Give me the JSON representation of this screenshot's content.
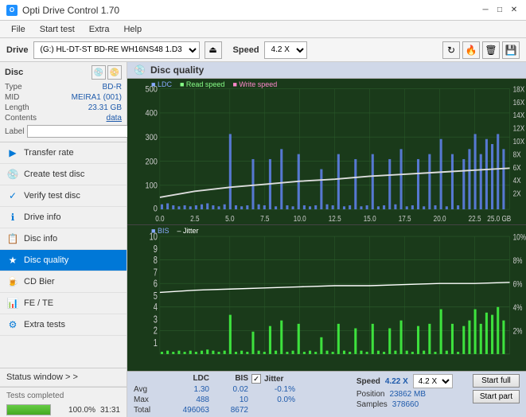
{
  "titlebar": {
    "title": "Opti Drive Control 1.70",
    "icon_text": "O",
    "minimize": "─",
    "maximize": "□",
    "close": "✕"
  },
  "menubar": {
    "items": [
      "File",
      "Start test",
      "Extra",
      "Help"
    ]
  },
  "drivebar": {
    "label": "Drive",
    "drive_value": "(G:)  HL-DT-ST BD-RE  WH16NS48 1.D3",
    "speed_label": "Speed",
    "speed_value": "4.2 X"
  },
  "disc": {
    "title": "Disc",
    "type_label": "Type",
    "type_value": "BD-R",
    "mid_label": "MID",
    "mid_value": "MEIRA1 (001)",
    "length_label": "Length",
    "length_value": "23.31 GB",
    "contents_label": "Contents",
    "contents_value": "data",
    "label_label": "Label",
    "label_value": ""
  },
  "nav": {
    "items": [
      {
        "id": "transfer-rate",
        "label": "Transfer rate",
        "icon": "▶"
      },
      {
        "id": "create-test-disc",
        "label": "Create test disc",
        "icon": "💿"
      },
      {
        "id": "verify-test-disc",
        "label": "Verify test disc",
        "icon": "✓"
      },
      {
        "id": "drive-info",
        "label": "Drive info",
        "icon": "ℹ"
      },
      {
        "id": "disc-info",
        "label": "Disc info",
        "icon": "📋"
      },
      {
        "id": "disc-quality",
        "label": "Disc quality",
        "icon": "★",
        "active": true
      },
      {
        "id": "cd-bier",
        "label": "CD Bier",
        "icon": "🍺"
      },
      {
        "id": "fe-te",
        "label": "FE / TE",
        "icon": "📊"
      },
      {
        "id": "extra-tests",
        "label": "Extra tests",
        "icon": "⚙"
      }
    ],
    "status_window": "Status window > >"
  },
  "chart": {
    "title": "Disc quality",
    "legend": {
      "ldc": "LDC",
      "read_speed": "Read speed",
      "write_speed": "Write speed"
    },
    "legend2": {
      "bis": "BIS",
      "jitter": "Jitter"
    },
    "top_y_max": 500,
    "top_y_labels": [
      "500",
      "400",
      "300",
      "200",
      "100",
      "0"
    ],
    "top_y_right_labels": [
      "18X",
      "16X",
      "14X",
      "12X",
      "10X",
      "8X",
      "6X",
      "4X",
      "2X"
    ],
    "bottom_y_max": 10,
    "bottom_y_labels": [
      "10",
      "9",
      "8",
      "7",
      "6",
      "5",
      "4",
      "3",
      "2",
      "1"
    ],
    "bottom_y_right": [
      "10%",
      "8%",
      "6%",
      "4%",
      "2%"
    ],
    "x_labels": [
      "0.0",
      "2.5",
      "5.0",
      "7.5",
      "10.0",
      "12.5",
      "15.0",
      "17.5",
      "20.0",
      "22.5",
      "25.0 GB"
    ]
  },
  "info_table": {
    "col_ldc": "LDC",
    "col_bis": "BIS",
    "col_jitter": "Jitter",
    "col_speed": "Speed",
    "col_position": "Position",
    "col_samples": "Samples",
    "avg_label": "Avg",
    "avg_ldc": "1.30",
    "avg_bis": "0.02",
    "avg_jitter": "-0.1%",
    "max_label": "Max",
    "max_ldc": "488",
    "max_bis": "10",
    "max_jitter": "0.0%",
    "total_label": "Total",
    "total_ldc": "496063",
    "total_bis": "8672",
    "speed_value": "4.22 X",
    "position_value": "23862 MB",
    "samples_value": "378660",
    "speed_select": "4.2 X",
    "start_full": "Start full",
    "start_part": "Start part"
  },
  "statusbar": {
    "label": "Tests completed",
    "progress": 100,
    "progress_text": "100.0%",
    "time": "31:31"
  }
}
